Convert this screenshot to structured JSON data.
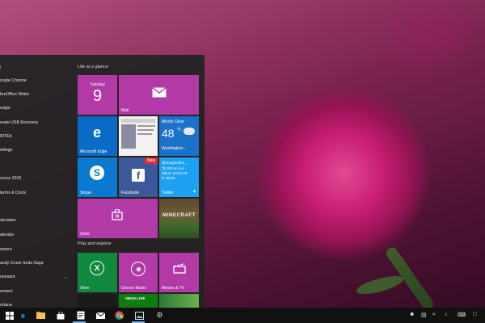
{
  "start_menu": {
    "apps": [
      {
        "text": "l",
        "kind": "letter"
      },
      {
        "text": "oogle Chrome",
        "kind": "app"
      },
      {
        "text": "breOffice Writer",
        "kind": "app"
      },
      {
        "text": "edgin",
        "kind": "app"
      },
      {
        "text": "reate USB Recovery",
        "kind": "app"
      },
      {
        "text": "RITEit",
        "kind": "app"
      },
      {
        "text": "ettings",
        "kind": "app"
      },
      {
        "text": "ccess 2016",
        "kind": "app"
      },
      {
        "text": "larms & Clock",
        "kind": "app"
      },
      {
        "text": "alculator",
        "kind": "app"
      },
      {
        "text": "alendar",
        "kind": "app"
      },
      {
        "text": "amera",
        "kind": "app"
      },
      {
        "text": "andy Crush Soda Saga",
        "kind": "app"
      },
      {
        "text": "onesant",
        "kind": "app"
      },
      {
        "text": "onnect",
        "kind": "app"
      },
      {
        "text": "ortana",
        "kind": "app"
      }
    ],
    "groups": {
      "life": "Life at a glance",
      "play": "Play and explore"
    },
    "tiles": {
      "calendar": {
        "day": "Tuesday",
        "date": "9"
      },
      "mail": {
        "label": "Mail"
      },
      "edge": {
        "label": "Microsoft Edge"
      },
      "weather": {
        "condition": "Mostly Clear",
        "temp": "48",
        "unit": "°F",
        "city": "Washington..."
      },
      "skype": {
        "label": "Skype"
      },
      "facebook": {
        "label": "Facebook",
        "badge": "New"
      },
      "twitter": {
        "label": "Twitter",
        "handle": "@imaginedra...",
        "tweet_line1": "\"$ 100 on our",
        "tweet_line2": "album EVOLVE",
        "tweet_line3": "is NOW..."
      },
      "store": {
        "label": "Store"
      },
      "minecraft": {
        "logo": "MINECRAFT"
      },
      "xbox": {
        "label": "Xbox"
      },
      "groove": {
        "label": "Groove Music"
      },
      "movies": {
        "label": "Movies & TV"
      },
      "xboxlive": {
        "label": "XBOX LIVE"
      }
    }
  },
  "taskbar": {
    "icons": [
      "windows-icon",
      "edge-icon",
      "file-explorer-icon",
      "store-icon",
      "word-icon",
      "mail-icon",
      "chrome-icon",
      "photos-icon",
      "settings-icon"
    ]
  },
  "colors": {
    "tile_magenta": "#b13aa7",
    "tile_blue": "#0a6ac7",
    "tile_green": "#10893e",
    "menu_bg": "#232323"
  }
}
